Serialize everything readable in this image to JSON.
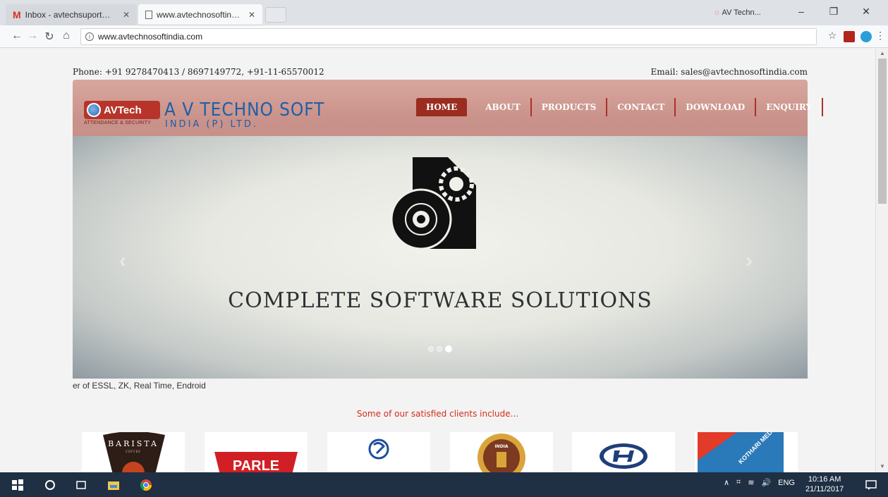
{
  "browser": {
    "tabs": [
      {
        "title": "Inbox - avtechsuport@gmail.com",
        "active": false
      },
      {
        "title": "www.avtechnosoftindia.com",
        "active": true
      }
    ],
    "profile_label": "AV Techn...",
    "url": "www.avtechnosoftindia.com"
  },
  "site": {
    "phone": "Phone: +91 9278470413 / 8697149772, +91-11-65570012",
    "email": "Email: sales@avtechnosoftindia.com",
    "logo_text": "AVTech",
    "logo_tagline": "ATTENDANCE & SECURITY",
    "company_name": "A V TECHNO SOFT",
    "company_sub": "INDIA (P) LTD.",
    "nav": [
      "HOME",
      "ABOUT",
      "PRODUCTS",
      "CONTACT",
      "DOWNLOAD",
      "ENQUIRY"
    ],
    "nav_active": "HOME",
    "slide_caption": "COMPLETE SOFTWARE SOLUTIONS",
    "slide_count": 3,
    "slide_active": 3,
    "marquee_text": "er of ESSL, ZK, Real Time, Endroid",
    "clients_heading": "Some of our satisfied clients include...",
    "clients": [
      {
        "name": "BARISTA",
        "sub": "COFFEE"
      },
      {
        "name": "PARLE"
      },
      {
        "name": "Ashok Leyland"
      },
      {
        "name": "INDIA"
      },
      {
        "name": "Hyundai"
      },
      {
        "name": "KOTHARI MEDICAL CENTRE"
      }
    ]
  },
  "taskbar": {
    "lang": "ENG",
    "time": "10:16 AM",
    "date": "21/11/2017"
  },
  "colors": {
    "accent_red": "#9a2c20",
    "brand_blue": "#1f5fa8",
    "heading_red": "#d42d1a"
  }
}
